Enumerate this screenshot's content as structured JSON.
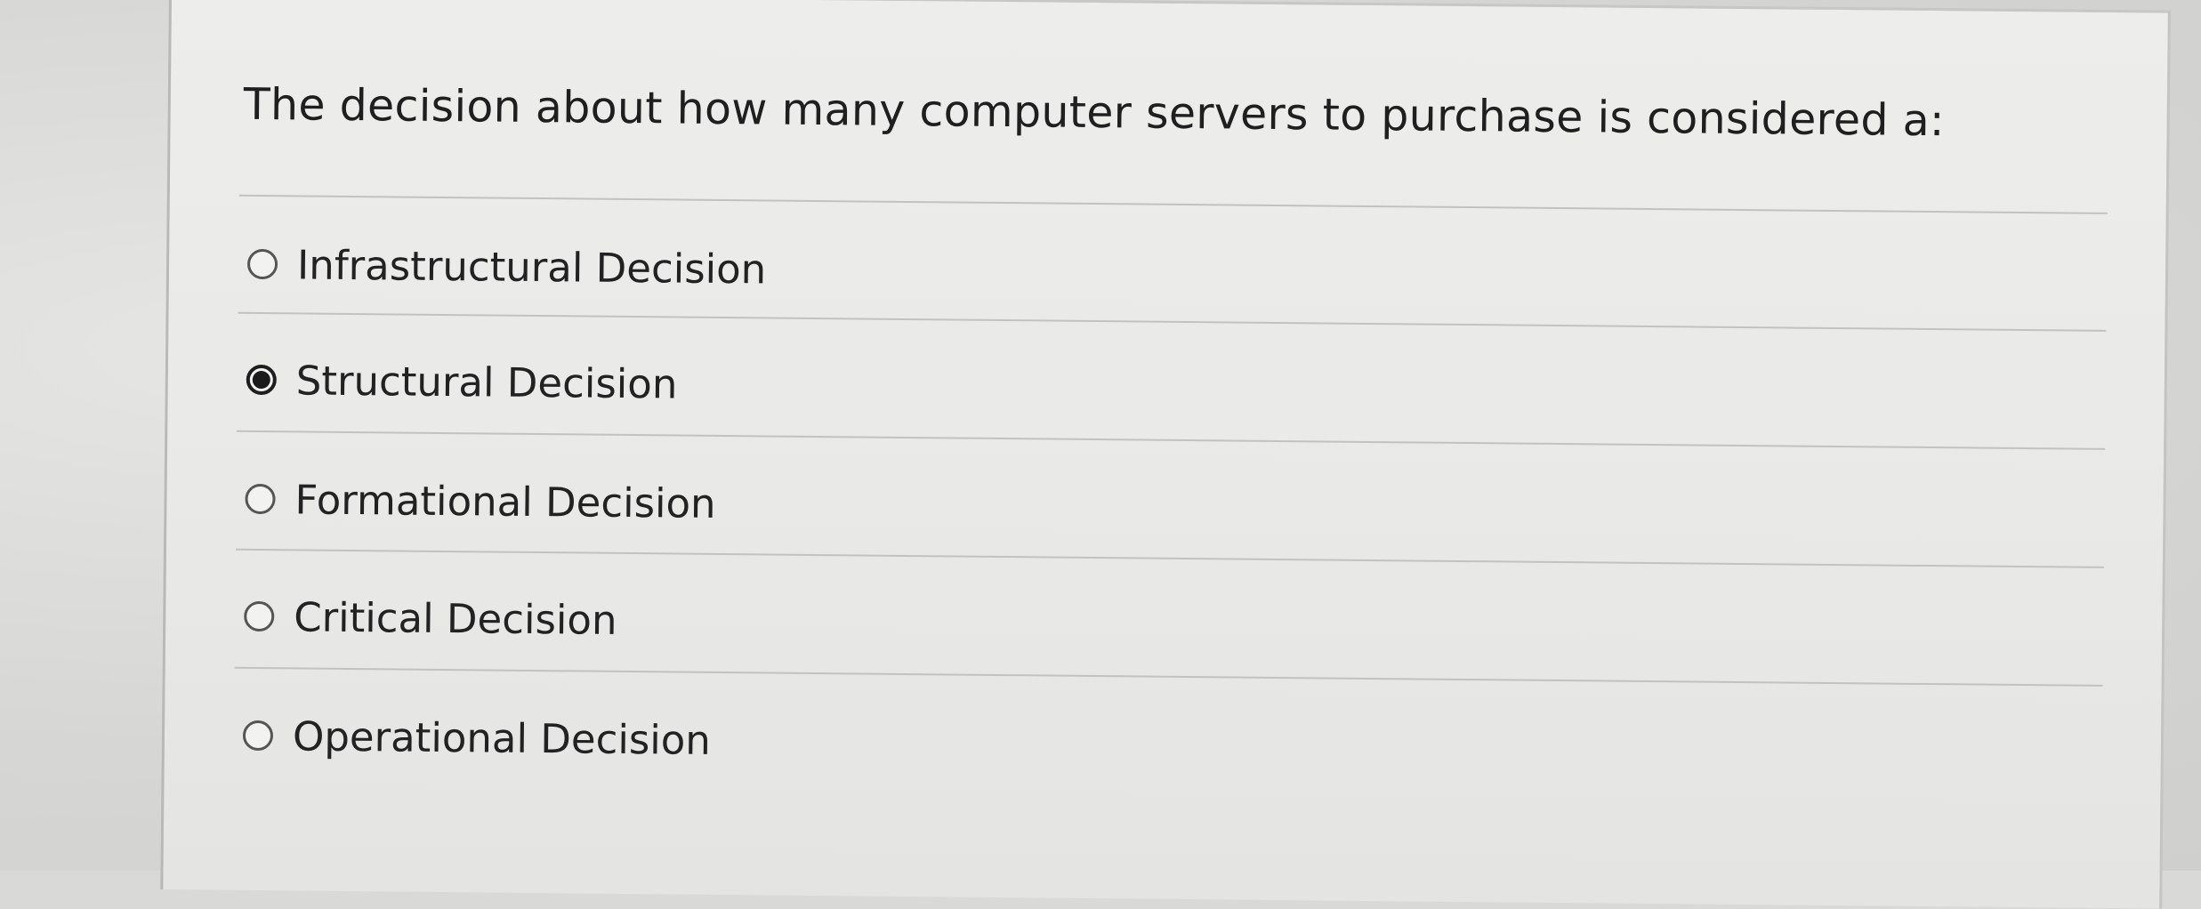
{
  "question": {
    "text": "The decision about how many computer servers to purchase is considered a:"
  },
  "options": [
    {
      "label": "Infrastructural Decision",
      "selected": false
    },
    {
      "label": "Structural Decision",
      "selected": true
    },
    {
      "label": "Formational Decision",
      "selected": false
    },
    {
      "label": "Critical Decision",
      "selected": false
    },
    {
      "label": "Operational Decision",
      "selected": false
    }
  ],
  "colors": {
    "card_background": "#ebebe9",
    "text": "#1f1f1f",
    "divider": "#c2c2c0",
    "radio_selected": "#1b1b1b"
  }
}
